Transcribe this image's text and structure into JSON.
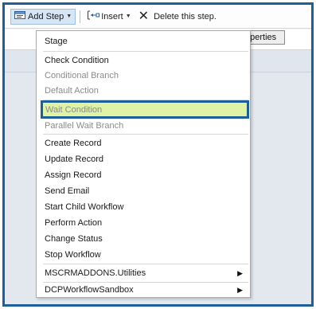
{
  "toolbar": {
    "add_step_label": "Add Step",
    "insert_label": "Insert",
    "delete_label": "Delete this step."
  },
  "background": {
    "properties_button_label": "operties"
  },
  "menu": {
    "items": [
      {
        "label": "Stage",
        "disabled": false
      },
      {
        "label": "Check Condition",
        "disabled": false
      },
      {
        "label": "Conditional Branch",
        "disabled": true
      },
      {
        "label": "Default Action",
        "disabled": true
      },
      {
        "label": "Wait Condition",
        "disabled": true,
        "highlighted": true
      },
      {
        "label": "Parallel Wait Branch",
        "disabled": true
      },
      {
        "label": "Create Record",
        "disabled": false
      },
      {
        "label": "Update Record",
        "disabled": false
      },
      {
        "label": "Assign Record",
        "disabled": false
      },
      {
        "label": "Send Email",
        "disabled": false
      },
      {
        "label": "Start Child Workflow",
        "disabled": false
      },
      {
        "label": "Perform Action",
        "disabled": false
      },
      {
        "label": "Change Status",
        "disabled": false
      },
      {
        "label": "Stop Workflow",
        "disabled": false
      },
      {
        "label": "MSCRMADDONS.Utilities",
        "disabled": false,
        "submenu": true
      },
      {
        "label": "DCPWorkflowSandbox",
        "disabled": false,
        "submenu": true
      }
    ]
  },
  "colors": {
    "highlight_fill": "#def3a6",
    "highlight_border": "#1f5f97",
    "frame_border": "#1f5f97"
  }
}
